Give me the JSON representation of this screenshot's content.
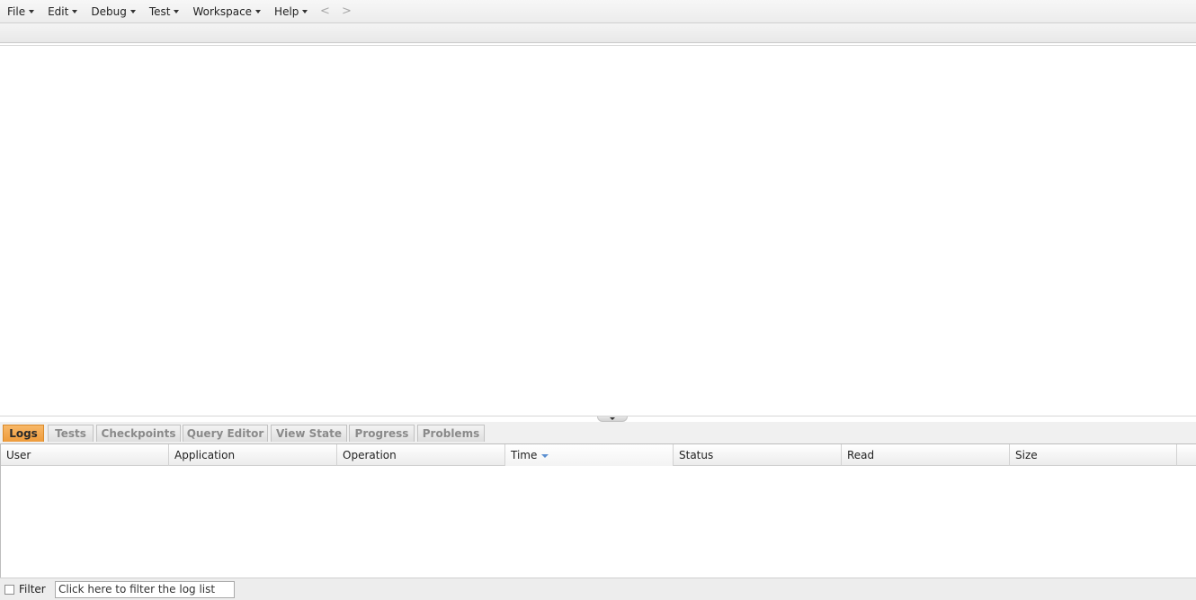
{
  "menubar": {
    "items": [
      "File",
      "Edit",
      "Debug",
      "Test",
      "Workspace",
      "Help"
    ],
    "back": "<",
    "forward": ">"
  },
  "tabs": {
    "items": [
      "Logs",
      "Tests",
      "Checkpoints",
      "Query Editor",
      "View State",
      "Progress",
      "Problems"
    ],
    "active": "Logs"
  },
  "grid": {
    "columns": [
      "User",
      "Application",
      "Operation",
      "Time",
      "Status",
      "Read",
      "Size"
    ],
    "sorted_column": "Time",
    "sort_direction": "descending",
    "rows": []
  },
  "filter": {
    "label": "Filter",
    "checked": false,
    "placeholder": "Click here to filter the log list"
  },
  "colors": {
    "active_tab": "#ef9f40",
    "sort_arrow": "#5b8fd1"
  }
}
